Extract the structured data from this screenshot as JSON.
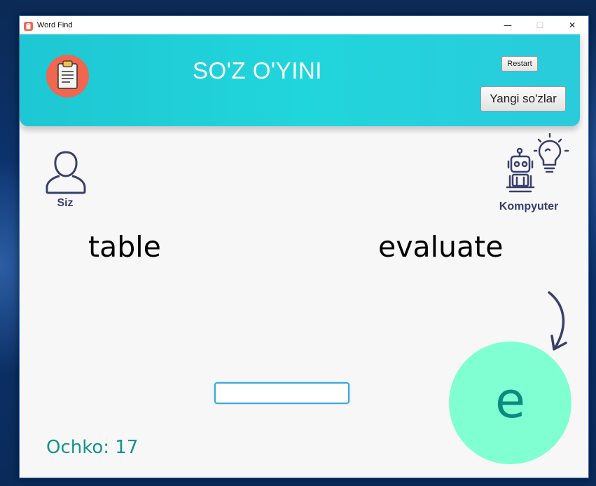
{
  "window": {
    "title": "Word Find",
    "minimize_glyph": "—",
    "maximize_glyph": "☐",
    "close_glyph": "✕"
  },
  "header": {
    "title": "SO'Z O'YINI",
    "restart_label": "Restart",
    "new_words_label": "Yangi so'zlar",
    "logo_icon": "clipboard-icon",
    "background_color": "#21d5dc"
  },
  "players": {
    "user": {
      "label": "Siz",
      "icon": "user-icon",
      "word": "table"
    },
    "computer": {
      "label": "Kompyuter",
      "icon": "robot-lightbulb-icon",
      "word": "evaluate"
    }
  },
  "current_letter": "e",
  "input": {
    "value": "",
    "placeholder": ""
  },
  "score": {
    "text": "Ochko: 17"
  },
  "colors": {
    "letter_circle": "#80ffd2",
    "letter_text": "#0b8a80",
    "score_text": "#14938d",
    "icon_stroke": "#3a3f6a",
    "logo_bg": "#f06650"
  }
}
